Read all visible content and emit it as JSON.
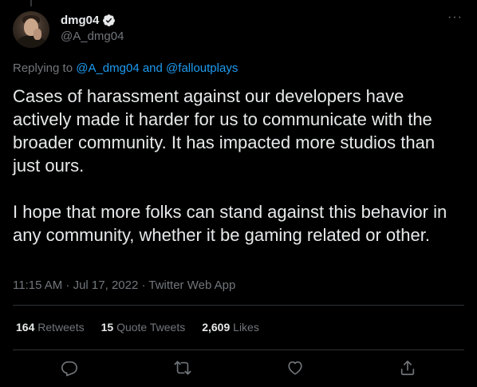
{
  "tweet": {
    "author": {
      "display_name": "dmg04",
      "handle": "@A_dmg04",
      "verified": true
    },
    "reply_context": {
      "prefix": "Replying to",
      "mention_1": "@A_dmg04",
      "joiner": "and",
      "mention_2": "@falloutplays"
    },
    "text_paragraphs": [
      "Cases of harassment against our developers have actively made it harder for us to communicate with the broader community. It has impacted more studios than just ours.",
      "I hope that more folks can stand against this behavior in any community, whether it be gaming related or other."
    ],
    "timestamp": "11:15 AM · Jul 17, 2022 · Twitter Web App",
    "stats": {
      "retweets_count": "164",
      "retweets_label": "Retweets",
      "quote_count": "15",
      "quote_label": "Quote Tweets",
      "likes_count": "2,609",
      "likes_label": "Likes"
    },
    "more_glyph": "···"
  },
  "colors": {
    "background": "#000000",
    "text": "#e7e9ea",
    "secondary": "#71767b",
    "accent": "#1d9bf0",
    "divider": "#2f3336"
  },
  "icons": [
    "verified-badge-icon",
    "more-icon",
    "reply-icon",
    "retweet-icon",
    "like-icon",
    "share-icon"
  ]
}
